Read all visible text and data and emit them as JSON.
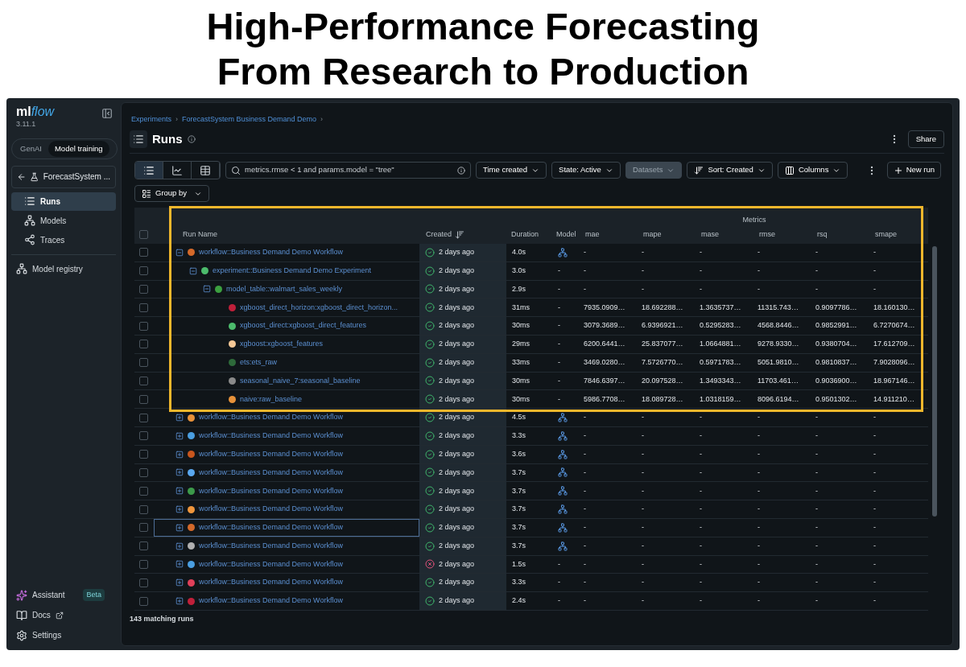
{
  "slide_title": [
    "High-Performance Forecasting",
    "From Research to Production"
  ],
  "sidebar": {
    "logo": {
      "prefix": "ml",
      "suffix": "flow"
    },
    "version": "3.11.1",
    "mode_toggle": [
      {
        "label": "GenAI",
        "selected": false
      },
      {
        "label": "Model training",
        "selected": true
      }
    ],
    "experiment": "ForecastSystem ...",
    "nav": [
      {
        "label": "Runs",
        "kind": "runs",
        "selected": true
      },
      {
        "label": "Models",
        "kind": "models",
        "selected": false
      },
      {
        "label": "Traces",
        "kind": "traces",
        "selected": false
      }
    ],
    "registry": "Model registry",
    "bottom": [
      {
        "label": "Assistant",
        "kind": "assistant",
        "badge": "Beta"
      },
      {
        "label": "Docs",
        "kind": "docs"
      },
      {
        "label": "Settings",
        "kind": "settings"
      }
    ]
  },
  "breadcrumbs": [
    {
      "label": "Experiments",
      "separator": "›"
    },
    {
      "label": "ForecastSystem Business Demand Demo",
      "separator": "›"
    }
  ],
  "page_title": "Runs",
  "share": "Share",
  "views": [
    {
      "kind": "list",
      "selected": true
    },
    {
      "kind": "chart",
      "selected": false
    },
    {
      "kind": "table",
      "selected": false
    }
  ],
  "search": {
    "value": "metrics.rmse < 1 and params.model = \"tree\""
  },
  "filters": [
    {
      "label": "Time created",
      "kind": "plain",
      "disabled": false
    },
    {
      "label": "State: Active",
      "kind": "plain",
      "disabled": false
    },
    {
      "label": "Datasets",
      "kind": "plain",
      "disabled": true
    },
    {
      "label": "Sort: Created",
      "kind": "sort",
      "disabled": false
    },
    {
      "label": "Columns",
      "kind": "columns",
      "disabled": false
    }
  ],
  "new_run": "New run",
  "group_by": "Group by",
  "table": {
    "metrics_group": "Metrics",
    "select_all_checked": false,
    "columns": [
      "Run Name",
      "Created",
      "Duration",
      "Model",
      "mae",
      "mape",
      "mase",
      "rmse",
      "rsq",
      "smape"
    ],
    "rows": [
      {
        "checked": false,
        "focused": false,
        "expanded": true,
        "color": "#d4692a",
        "name": "workflow::Business Demand Demo Workflow",
        "failed": false,
        "created": "2 days ago",
        "duration": "4.0s",
        "model_logged": true,
        "metrics": [
          "-",
          "-",
          "-",
          "-",
          "-",
          "-"
        ],
        "children": [
          {
            "checked": false,
            "focused": false,
            "expanded": true,
            "color": "#4cbb6c",
            "name": "experiment::Business Demand Demo Experiment",
            "failed": false,
            "created": "2 days ago",
            "duration": "3.0s",
            "model_logged": false,
            "model_text": "-",
            "metrics": [
              "-",
              "-",
              "-",
              "-",
              "-",
              "-"
            ],
            "children": [
              {
                "checked": false,
                "focused": false,
                "expanded": true,
                "color": "#3ca040",
                "name": "model_table::walmart_sales_weekly",
                "failed": false,
                "created": "2 days ago",
                "duration": "2.9s",
                "model_logged": false,
                "model_text": "-",
                "metrics": [
                  "-",
                  "-",
                  "-",
                  "-",
                  "-",
                  "-"
                ],
                "children": [
                  {
                    "checked": false,
                    "focused": false,
                    "color": "#c0203a",
                    "name": "xgboost_direct_horizon:xgboost_direct_horizon...",
                    "failed": false,
                    "created": "2 days ago",
                    "duration": "31ms",
                    "model_logged": false,
                    "model_text": "-",
                    "metrics": [
                      "7935.0909…",
                      "18.692288…",
                      "1.3635737…",
                      "11315.743…",
                      "0.9097786…",
                      "18.160130…"
                    ]
                  },
                  {
                    "checked": false,
                    "focused": false,
                    "color": "#4cbb6c",
                    "name": "xgboost_direct:xgboost_direct_features",
                    "failed": false,
                    "created": "2 days ago",
                    "duration": "30ms",
                    "model_logged": false,
                    "model_text": "-",
                    "metrics": [
                      "3079.3689…",
                      "6.9396921…",
                      "0.5295283…",
                      "4568.8446…",
                      "0.9852991…",
                      "6.7270674…"
                    ]
                  },
                  {
                    "checked": false,
                    "focused": false,
                    "color": "#f5c896",
                    "name": "xgboost:xgboost_features",
                    "failed": false,
                    "created": "2 days ago",
                    "duration": "29ms",
                    "model_logged": false,
                    "model_text": "-",
                    "metrics": [
                      "6200.6441…",
                      "25.837077…",
                      "1.0664881…",
                      "9278.9330…",
                      "0.9380704…",
                      "17.612709…"
                    ]
                  },
                  {
                    "checked": false,
                    "focused": false,
                    "color": "#2e6a3a",
                    "name": "ets:ets_raw",
                    "failed": false,
                    "created": "2 days ago",
                    "duration": "33ms",
                    "model_logged": false,
                    "model_text": "-",
                    "metrics": [
                      "3469.0280…",
                      "7.5726770…",
                      "0.5971783…",
                      "5051.9810…",
                      "0.9810837…",
                      "7.9028096…"
                    ]
                  },
                  {
                    "checked": false,
                    "focused": false,
                    "color": "#8a8a8a",
                    "name": "seasonal_naive_7:seasonal_baseline",
                    "failed": false,
                    "created": "2 days ago",
                    "duration": "30ms",
                    "model_logged": false,
                    "model_text": "-",
                    "metrics": [
                      "7846.6397…",
                      "20.097528…",
                      "1.3493343…",
                      "11703.461…",
                      "0.9036900…",
                      "18.967146…"
                    ]
                  },
                  {
                    "checked": false,
                    "focused": false,
                    "color": "#e8923a",
                    "name": "naive:raw_baseline",
                    "failed": false,
                    "created": "2 days ago",
                    "duration": "30ms",
                    "model_logged": false,
                    "model_text": "-",
                    "metrics": [
                      "5986.7708…",
                      "18.089728…",
                      "1.0318159…",
                      "8096.6194…",
                      "0.9501302…",
                      "14.911210…"
                    ]
                  }
                ]
              }
            ]
          }
        ]
      },
      {
        "checked": false,
        "focused": false,
        "expanded": false,
        "color": "#e8923a",
        "name": "workflow::Business Demand Demo Workflow",
        "failed": false,
        "created": "2 days ago",
        "duration": "4.5s",
        "model_logged": true,
        "metrics": [
          "-",
          "-",
          "-",
          "-",
          "-",
          "-"
        ]
      },
      {
        "checked": false,
        "focused": false,
        "expanded": false,
        "color": "#4a9ee0",
        "name": "workflow::Business Demand Demo Workflow",
        "failed": false,
        "created": "2 days ago",
        "duration": "3.3s",
        "model_logged": true,
        "metrics": [
          "-",
          "-",
          "-",
          "-",
          "-",
          "-"
        ]
      },
      {
        "checked": false,
        "focused": false,
        "expanded": false,
        "color": "#c8561e",
        "name": "workflow::Business Demand Demo Workflow",
        "failed": false,
        "created": "2 days ago",
        "duration": "3.6s",
        "model_logged": true,
        "metrics": [
          "-",
          "-",
          "-",
          "-",
          "-",
          "-"
        ]
      },
      {
        "checked": false,
        "focused": false,
        "expanded": false,
        "color": "#5aa8f0",
        "name": "workflow::Business Demand Demo Workflow",
        "failed": false,
        "created": "2 days ago",
        "duration": "3.7s",
        "model_logged": true,
        "metrics": [
          "-",
          "-",
          "-",
          "-",
          "-",
          "-"
        ]
      },
      {
        "checked": false,
        "focused": false,
        "expanded": false,
        "color": "#3c9a4a",
        "name": "workflow::Business Demand Demo Workflow",
        "failed": false,
        "created": "2 days ago",
        "duration": "3.7s",
        "model_logged": true,
        "metrics": [
          "-",
          "-",
          "-",
          "-",
          "-",
          "-"
        ]
      },
      {
        "checked": false,
        "focused": false,
        "expanded": false,
        "color": "#f0963c",
        "name": "workflow::Business Demand Demo Workflow",
        "failed": false,
        "created": "2 days ago",
        "duration": "3.7s",
        "model_logged": true,
        "metrics": [
          "-",
          "-",
          "-",
          "-",
          "-",
          "-"
        ]
      },
      {
        "checked": false,
        "focused": true,
        "expanded": false,
        "color": "#d4692a",
        "name": "workflow::Business Demand Demo Workflow",
        "failed": false,
        "created": "2 days ago",
        "duration": "3.7s",
        "model_logged": true,
        "metrics": [
          "-",
          "-",
          "-",
          "-",
          "-",
          "-"
        ]
      },
      {
        "checked": false,
        "focused": false,
        "expanded": false,
        "color": "#b0b0b0",
        "name": "workflow::Business Demand Demo Workflow",
        "failed": false,
        "created": "2 days ago",
        "duration": "3.7s",
        "model_logged": true,
        "metrics": [
          "-",
          "-",
          "-",
          "-",
          "-",
          "-"
        ]
      },
      {
        "checked": false,
        "focused": false,
        "expanded": false,
        "color": "#4a9ee0",
        "name": "workflow::Business Demand Demo Workflow",
        "failed": true,
        "created": "2 days ago",
        "duration": "1.5s",
        "model_logged": false,
        "model_text": "-",
        "metrics": [
          "-",
          "-",
          "-",
          "-",
          "-",
          "-"
        ]
      },
      {
        "checked": false,
        "focused": false,
        "expanded": false,
        "color": "#e0405a",
        "name": "workflow::Business Demand Demo Workflow",
        "failed": false,
        "created": "2 days ago",
        "duration": "3.3s",
        "model_logged": false,
        "model_text": "-",
        "metrics": [
          "-",
          "-",
          "-",
          "-",
          "-",
          "-"
        ]
      },
      {
        "checked": false,
        "focused": false,
        "expanded": false,
        "color": "#c0203a",
        "name": "workflow::Business Demand Demo Workflow",
        "failed": false,
        "created": "2 days ago",
        "duration": "2.4s",
        "model_logged": false,
        "model_text": "-",
        "metrics": [
          "-",
          "-",
          "-",
          "-",
          "-",
          "-"
        ]
      }
    ],
    "footer": "143 matching runs"
  }
}
